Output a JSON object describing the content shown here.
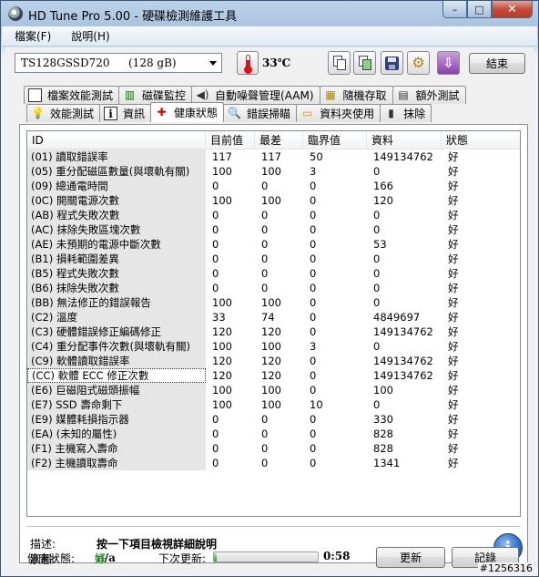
{
  "window": {
    "title": "HD Tune Pro 5.00 - 硬碟檢測維護工具",
    "controls": [
      "–",
      "□",
      "✕"
    ]
  },
  "menu": {
    "file": "檔案(F)",
    "help": "說明(H)"
  },
  "toolbar": {
    "drive_model": "TS128GSSD720",
    "drive_capacity": "(128 gB)",
    "temperature": "33℃",
    "exit_label": "結束",
    "icons": [
      "copy-text-icon",
      "copy-screenshot-icon",
      "save-icon",
      "options-icon",
      "exit-icon"
    ]
  },
  "tabs": {
    "row1": [
      "檔案效能測試",
      "磁碟監控",
      "自動噪聲管理(AAM)",
      "隨機存取",
      "額外測試"
    ],
    "row2": [
      "效能測試",
      "資訊",
      "健康狀態",
      "錯誤掃瞄",
      "資料夾使用",
      "抹除"
    ],
    "active": "健康狀態"
  },
  "grid": {
    "headers": [
      "ID",
      "目前值",
      "最差",
      "臨界值",
      "資料",
      "狀態"
    ],
    "rows": [
      [
        "(01) 讀取錯誤率",
        "117",
        "117",
        "50",
        "149134762",
        "好"
      ],
      [
        "(05) 重分配磁區數量(與壞軌有關)",
        "100",
        "100",
        "3",
        "0",
        "好"
      ],
      [
        "(09) 總通電時間",
        "0",
        "0",
        "0",
        "166",
        "好"
      ],
      [
        "(0C) 開關電源次數",
        "100",
        "100",
        "0",
        "120",
        "好"
      ],
      [
        "(AB) 程式失敗次數",
        "0",
        "0",
        "0",
        "0",
        "好"
      ],
      [
        "(AC) 抹除失敗區塊次數",
        "0",
        "0",
        "0",
        "0",
        "好"
      ],
      [
        "(AE) 未預期的電源中斷次數",
        "0",
        "0",
        "0",
        "53",
        "好"
      ],
      [
        "(B1) 損耗範圍差異",
        "0",
        "0",
        "0",
        "0",
        "好"
      ],
      [
        "(B5) 程式失敗次數",
        "0",
        "0",
        "0",
        "0",
        "好"
      ],
      [
        "(B6) 抹除失敗次數",
        "0",
        "0",
        "0",
        "0",
        "好"
      ],
      [
        "(BB) 無法修正的錯誤報告",
        "100",
        "100",
        "0",
        "0",
        "好"
      ],
      [
        "(C2) 溫度",
        "33",
        "74",
        "0",
        "4849697",
        "好"
      ],
      [
        "(C3) 硬體錯誤修正編碼修正",
        "120",
        "120",
        "0",
        "149134762",
        "好"
      ],
      [
        "(C4) 重分配事件次數(與壞軌有關)",
        "100",
        "100",
        "3",
        "0",
        "好"
      ],
      [
        "(C9) 軟體讀取錯誤率",
        "120",
        "120",
        "0",
        "149134762",
        "好"
      ],
      [
        "(CC) 軟體 ECC 修正次數",
        "120",
        "120",
        "0",
        "149134762",
        "好"
      ],
      [
        "(E6) 巨磁阻式磁頭振幅",
        "100",
        "100",
        "0",
        "100",
        "好"
      ],
      [
        "(E7) SSD 壽命剩下",
        "100",
        "100",
        "10",
        "0",
        "好"
      ],
      [
        "(E9) 媒體耗損指示器",
        "0",
        "0",
        "0",
        "330",
        "好"
      ],
      [
        "(EA) (未知的屬性)",
        "0",
        "0",
        "0",
        "828",
        "好"
      ],
      [
        "(F1) 主機寫入壽命",
        "0",
        "0",
        "0",
        "828",
        "好"
      ],
      [
        "(F2) 主機讀取壽命",
        "0",
        "0",
        "0",
        "1341",
        "好"
      ]
    ],
    "selected_index": 15
  },
  "description": {
    "desc_label": "描述:",
    "desc_value": "按一下項目檢視詳細說明",
    "status_label": "狀態:",
    "status_value": "n/a"
  },
  "status_bar": {
    "health_label": "健康狀態:",
    "health_value": "好",
    "next_update_label": "下次更新:",
    "progress_fraction": 0.03,
    "time_remaining": "0:58",
    "refresh_label": "更新",
    "log_label": "記錄"
  },
  "watermark": "#1256316",
  "colors": {
    "health_good": "#21a321",
    "id_column_bg": "#e6e6e6"
  }
}
